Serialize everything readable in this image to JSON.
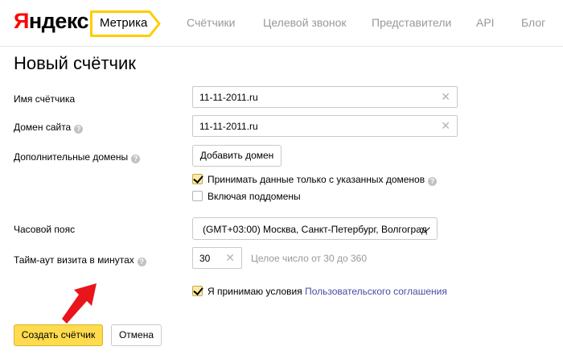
{
  "header": {
    "logo": {
      "first": "Я",
      "rest": "ндекс"
    },
    "product": "Метрика",
    "nav": [
      {
        "label": "Счётчики"
      },
      {
        "label": "Целевой звонок"
      },
      {
        "label": "Представители"
      },
      {
        "label": "API"
      },
      {
        "label": "Блог"
      }
    ]
  },
  "page": {
    "title": "Новый счётчик"
  },
  "form": {
    "name": {
      "label": "Имя счётчика",
      "value": "11-11-2011.ru"
    },
    "domain": {
      "label": "Домен сайта",
      "value": "11-11-2011.ru"
    },
    "extra_domains": {
      "label": "Дополнительные домены",
      "add_button": "Добавить домен"
    },
    "only_domains": {
      "label": "Принимать данные только с указанных доменов",
      "checked": true
    },
    "subdomains": {
      "label": "Включая поддомены",
      "checked": false
    },
    "timezone": {
      "label": "Часовой пояс",
      "value": "(GMT+03:00) Москва, Санкт-Петербург, Волгоград"
    },
    "timeout": {
      "label": "Тайм-аут визита в минутах",
      "value": "30",
      "hint": "Целое число от 30 до 360"
    },
    "agreement": {
      "text": "Я принимаю условия",
      "link": "Пользовательского соглашения",
      "checked": true
    }
  },
  "actions": {
    "create": "Создать счётчик",
    "cancel": "Отмена"
  },
  "icons": {
    "help": "?",
    "clear": "✕"
  },
  "colors": {
    "accent": "#ffdb4d",
    "logo_red": "#ff0000",
    "link": "#4a4aa8",
    "arrow": "#e8161b"
  }
}
